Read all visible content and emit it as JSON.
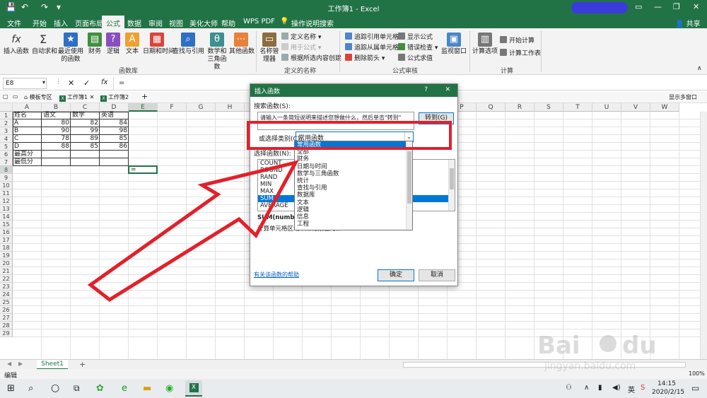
{
  "titlebar": {
    "title": "工作簿1  -  Excel",
    "undo": "↶",
    "redo": "↷",
    "minimize": "—",
    "restore": "❐",
    "close": "✕"
  },
  "tabs": [
    "文件",
    "开始",
    "插入",
    "页面布局",
    "公式",
    "数据",
    "审阅",
    "视图",
    "美化大师",
    "帮助",
    "WPS PDF",
    "操作说明搜索"
  ],
  "share": "共享",
  "ribbon": {
    "library": {
      "insert_func": "插入函数",
      "autosum": "自动求和",
      "recent": "最近使用的函数",
      "finance": "财务",
      "logic": "逻辑",
      "text": "文本",
      "datetime": "日期和时间",
      "lookup": "查找与引用",
      "math": "数学和三角函数",
      "other": "其他函数",
      "group_label": "函数库"
    },
    "names": {
      "name_manager": "名称管理器",
      "define": "定义名称",
      "use_in_formula": "用于公式",
      "create_from": "根据所选内容创建",
      "group_label": "定义的名称"
    },
    "audit": {
      "trace_prec": "追踪引用单元格",
      "trace_dep": "追踪从属单元格",
      "remove_arrows": "删除箭头",
      "show_formulas": "显示公式",
      "error_check": "错误检查",
      "evaluate": "公式求值",
      "watch": "监视窗口",
      "group_label": "公式审核"
    },
    "calc": {
      "options": "计算选项",
      "calc_now": "开始计算",
      "calc_sheet": "计算工作表",
      "group_label": "计算"
    }
  },
  "formula_bar": {
    "cell_ref": "E8",
    "cancel": "✕",
    "enter": "✓",
    "fx": "fx",
    "content": "="
  },
  "workbook_tabs": {
    "template": "模板专区",
    "book1": "工作簿1",
    "book2": "工作簿2",
    "add": "+",
    "status": "显示多窗口"
  },
  "grid": {
    "columns": [
      "A",
      "B",
      "C",
      "D",
      "E",
      "F",
      "G",
      "H",
      "I",
      "J",
      "K",
      "L",
      "M",
      "N",
      "O",
      "P",
      "Q",
      "R",
      "S",
      "T",
      "U",
      "V",
      "W"
    ],
    "rows": [
      "1",
      "2",
      "3",
      "4",
      "5",
      "6",
      "7",
      "8",
      "9",
      "10",
      "11",
      "12",
      "13",
      "14",
      "15",
      "16",
      "17",
      "18",
      "19",
      "20",
      "21",
      "22",
      "23",
      "24",
      "25",
      "26",
      "27",
      "28",
      "29"
    ],
    "table": [
      [
        "姓名",
        "语文",
        "数学",
        "英语"
      ],
      [
        "A",
        "80",
        "82",
        "84"
      ],
      [
        "B",
        "90",
        "99",
        "98"
      ],
      [
        "C",
        "78",
        "89",
        "85"
      ],
      [
        "D",
        "88",
        "85",
        "86"
      ],
      [
        "最高分",
        "",
        "",
        ""
      ],
      [
        "最低分",
        "",
        "",
        ""
      ]
    ],
    "active_cell_value": "="
  },
  "sheet": {
    "name": "Sheet1",
    "add": "+"
  },
  "status": {
    "mode": "编辑",
    "zoom": "100%"
  },
  "taskbar": {
    "time": "14:15",
    "date": "2020/2/15"
  },
  "dialog": {
    "title": "插入函数",
    "help": "?",
    "close": "✕",
    "search_label": "搜索函数(S):",
    "search_value": "请输入一条简短说明来描述您想做什么，然后单击\"转到\"",
    "goto": "转到(G)",
    "category_label": "或选择类别(C):",
    "category_value": "常用函数",
    "select_label": "选择函数(N):",
    "functions": [
      "COUNT",
      "ROUND",
      "RAND",
      "MIN",
      "MAX",
      "SUM",
      "AVERAGE"
    ],
    "selected_function": "SUM",
    "syntax": "SUM(number1,number2,...)",
    "description": "计算单元格区域中所有数值的和",
    "help_link": "有关该函数的帮助",
    "ok": "确定",
    "cancel": "取消"
  },
  "dropdown": {
    "items": [
      "常用函数",
      "全部",
      "财务",
      "日期与时间",
      "数学与三角函数",
      "统计",
      "查找与引用",
      "数据库",
      "文本",
      "逻辑",
      "信息",
      "工程"
    ],
    "selected": "常用函数"
  },
  "colors": {
    "excel_green": "#217346",
    "highlight_red": "#e3202a",
    "selection_blue": "#0078d7"
  }
}
